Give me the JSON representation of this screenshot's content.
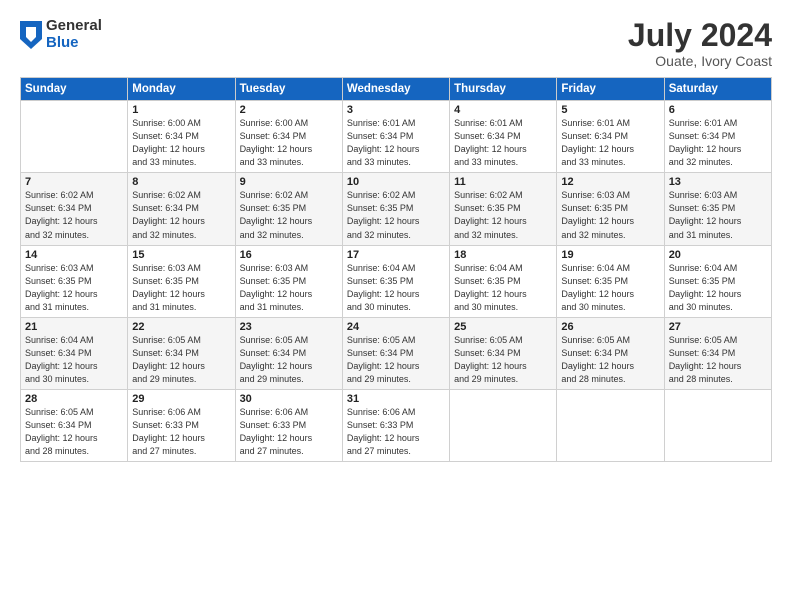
{
  "logo": {
    "general": "General",
    "blue": "Blue"
  },
  "title": "July 2024",
  "subtitle": "Ouate, Ivory Coast",
  "header_days": [
    "Sunday",
    "Monday",
    "Tuesday",
    "Wednesday",
    "Thursday",
    "Friday",
    "Saturday"
  ],
  "weeks": [
    [
      {
        "day": "",
        "info": ""
      },
      {
        "day": "1",
        "info": "Sunrise: 6:00 AM\nSunset: 6:34 PM\nDaylight: 12 hours\nand 33 minutes."
      },
      {
        "day": "2",
        "info": "Sunrise: 6:00 AM\nSunset: 6:34 PM\nDaylight: 12 hours\nand 33 minutes."
      },
      {
        "day": "3",
        "info": "Sunrise: 6:01 AM\nSunset: 6:34 PM\nDaylight: 12 hours\nand 33 minutes."
      },
      {
        "day": "4",
        "info": "Sunrise: 6:01 AM\nSunset: 6:34 PM\nDaylight: 12 hours\nand 33 minutes."
      },
      {
        "day": "5",
        "info": "Sunrise: 6:01 AM\nSunset: 6:34 PM\nDaylight: 12 hours\nand 33 minutes."
      },
      {
        "day": "6",
        "info": "Sunrise: 6:01 AM\nSunset: 6:34 PM\nDaylight: 12 hours\nand 32 minutes."
      }
    ],
    [
      {
        "day": "7",
        "info": "Sunrise: 6:02 AM\nSunset: 6:34 PM\nDaylight: 12 hours\nand 32 minutes."
      },
      {
        "day": "8",
        "info": "Sunrise: 6:02 AM\nSunset: 6:34 PM\nDaylight: 12 hours\nand 32 minutes."
      },
      {
        "day": "9",
        "info": "Sunrise: 6:02 AM\nSunset: 6:35 PM\nDaylight: 12 hours\nand 32 minutes."
      },
      {
        "day": "10",
        "info": "Sunrise: 6:02 AM\nSunset: 6:35 PM\nDaylight: 12 hours\nand 32 minutes."
      },
      {
        "day": "11",
        "info": "Sunrise: 6:02 AM\nSunset: 6:35 PM\nDaylight: 12 hours\nand 32 minutes."
      },
      {
        "day": "12",
        "info": "Sunrise: 6:03 AM\nSunset: 6:35 PM\nDaylight: 12 hours\nand 32 minutes."
      },
      {
        "day": "13",
        "info": "Sunrise: 6:03 AM\nSunset: 6:35 PM\nDaylight: 12 hours\nand 31 minutes."
      }
    ],
    [
      {
        "day": "14",
        "info": "Sunrise: 6:03 AM\nSunset: 6:35 PM\nDaylight: 12 hours\nand 31 minutes."
      },
      {
        "day": "15",
        "info": "Sunrise: 6:03 AM\nSunset: 6:35 PM\nDaylight: 12 hours\nand 31 minutes."
      },
      {
        "day": "16",
        "info": "Sunrise: 6:03 AM\nSunset: 6:35 PM\nDaylight: 12 hours\nand 31 minutes."
      },
      {
        "day": "17",
        "info": "Sunrise: 6:04 AM\nSunset: 6:35 PM\nDaylight: 12 hours\nand 30 minutes."
      },
      {
        "day": "18",
        "info": "Sunrise: 6:04 AM\nSunset: 6:35 PM\nDaylight: 12 hours\nand 30 minutes."
      },
      {
        "day": "19",
        "info": "Sunrise: 6:04 AM\nSunset: 6:35 PM\nDaylight: 12 hours\nand 30 minutes."
      },
      {
        "day": "20",
        "info": "Sunrise: 6:04 AM\nSunset: 6:35 PM\nDaylight: 12 hours\nand 30 minutes."
      }
    ],
    [
      {
        "day": "21",
        "info": "Sunrise: 6:04 AM\nSunset: 6:34 PM\nDaylight: 12 hours\nand 30 minutes."
      },
      {
        "day": "22",
        "info": "Sunrise: 6:05 AM\nSunset: 6:34 PM\nDaylight: 12 hours\nand 29 minutes."
      },
      {
        "day": "23",
        "info": "Sunrise: 6:05 AM\nSunset: 6:34 PM\nDaylight: 12 hours\nand 29 minutes."
      },
      {
        "day": "24",
        "info": "Sunrise: 6:05 AM\nSunset: 6:34 PM\nDaylight: 12 hours\nand 29 minutes."
      },
      {
        "day": "25",
        "info": "Sunrise: 6:05 AM\nSunset: 6:34 PM\nDaylight: 12 hours\nand 29 minutes."
      },
      {
        "day": "26",
        "info": "Sunrise: 6:05 AM\nSunset: 6:34 PM\nDaylight: 12 hours\nand 28 minutes."
      },
      {
        "day": "27",
        "info": "Sunrise: 6:05 AM\nSunset: 6:34 PM\nDaylight: 12 hours\nand 28 minutes."
      }
    ],
    [
      {
        "day": "28",
        "info": "Sunrise: 6:05 AM\nSunset: 6:34 PM\nDaylight: 12 hours\nand 28 minutes."
      },
      {
        "day": "29",
        "info": "Sunrise: 6:06 AM\nSunset: 6:33 PM\nDaylight: 12 hours\nand 27 minutes."
      },
      {
        "day": "30",
        "info": "Sunrise: 6:06 AM\nSunset: 6:33 PM\nDaylight: 12 hours\nand 27 minutes."
      },
      {
        "day": "31",
        "info": "Sunrise: 6:06 AM\nSunset: 6:33 PM\nDaylight: 12 hours\nand 27 minutes."
      },
      {
        "day": "",
        "info": ""
      },
      {
        "day": "",
        "info": ""
      },
      {
        "day": "",
        "info": ""
      }
    ]
  ]
}
